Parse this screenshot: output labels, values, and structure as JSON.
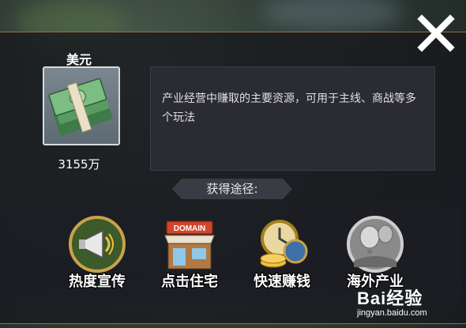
{
  "item": {
    "name": "美元",
    "amount": "3155万",
    "description": "产业经营中赚取的主要资源，可用于主线、商战等多个玩法",
    "icon": "money-stack-icon"
  },
  "sources": {
    "header": "获得途径:",
    "buttons": [
      {
        "label": "热度宣传",
        "icon": "megaphone-icon"
      },
      {
        "label": "点击住宅",
        "icon": "domain-shop-icon",
        "icon_text": "DOMAIN"
      },
      {
        "label": "快速赚钱",
        "icon": "clock-coins-icon"
      },
      {
        "label": "海外产业",
        "icon": "hot-air-balloon-icon"
      }
    ]
  },
  "watermark": {
    "text": "Bai经验",
    "url": "jingyan.baidu.com"
  },
  "colors": {
    "accent_gold": "#c9a24a",
    "panel": "#2a2b33"
  }
}
